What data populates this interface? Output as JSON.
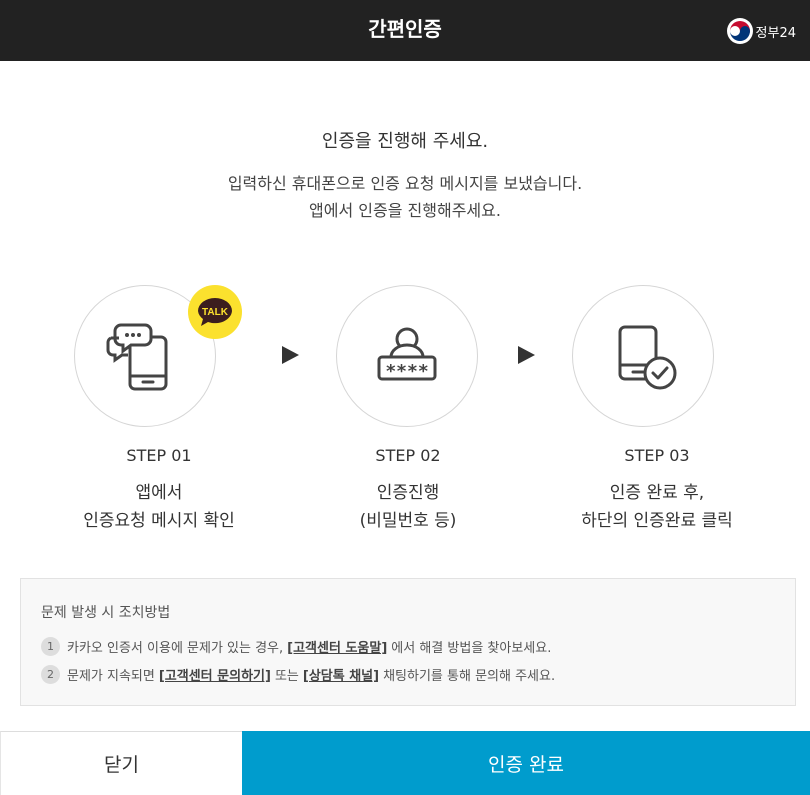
{
  "header": {
    "title": "간편인증",
    "gov_logo_text": "정부24",
    "logo_icon": "taegeuk-emblem-icon"
  },
  "intro": {
    "title": "인증을 진행해 주세요.",
    "line1": "입력하신 휴대폰으로 인증 요청 메시지를 보냈습니다.",
    "line2": "앱에서 인증을 진행해주세요."
  },
  "steps": [
    {
      "label": "STEP 01",
      "desc1": "앱에서",
      "desc2": "인증요청 메시지 확인",
      "icon": "phone-chat-icon",
      "badge": "TALK"
    },
    {
      "label": "STEP 02",
      "desc1": "인증진행",
      "desc2": "(비밀번호 등)",
      "icon": "user-password-icon",
      "password_mask": "****"
    },
    {
      "label": "STEP 03",
      "desc1": "인증 완료 후,",
      "desc2": "하단의 인증완료 클릭",
      "icon": "phone-check-icon"
    }
  ],
  "help": {
    "title": "문제 발생 시 조치방법",
    "items": [
      {
        "num": "1",
        "before": "카카오 인증서 이용에 문제가 있는 경우,",
        "link": "[고객센터 도움말]",
        "after": "에서 해결 방법을 찾아보세요."
      },
      {
        "num": "2",
        "before": "문제가 지속되면",
        "link": "[고객센터 문의하기]",
        "middle": "또는",
        "link2": "[상담톡 채널]",
        "after": "채팅하기를 통해 문의해 주세요."
      }
    ]
  },
  "buttons": {
    "close": "닫기",
    "confirm": "인증 완료"
  },
  "colors": {
    "header_bg": "#222222",
    "confirm_bg": "#009ccd",
    "kakao_yellow": "#fbe12e"
  }
}
